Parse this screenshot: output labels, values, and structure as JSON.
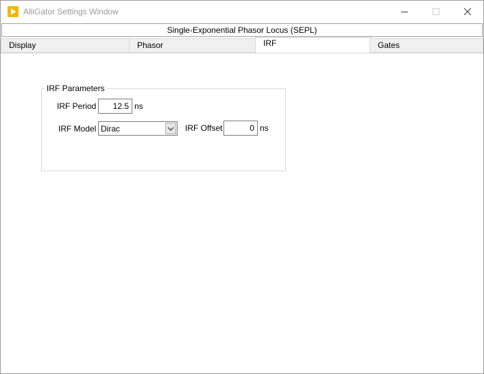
{
  "window": {
    "title": "AlliGator Settings Window",
    "accent_color": "#f2b800"
  },
  "banner": {
    "text": "Single-Exponential Phasor Locus (SEPL)"
  },
  "tabs": [
    {
      "label": "Display",
      "active": false
    },
    {
      "label": "Phasor",
      "active": false
    },
    {
      "label": "IRF",
      "active": true
    },
    {
      "label": "Gates",
      "active": false
    }
  ],
  "irf_parameters": {
    "title": "IRF Parameters",
    "period": {
      "label": "IRF Period",
      "value": "12.5",
      "unit": "ns"
    },
    "model": {
      "label": "IRF Model",
      "value": "Dirac"
    },
    "offset": {
      "label": "IRF Offset",
      "value": "0",
      "unit": "ns"
    }
  }
}
